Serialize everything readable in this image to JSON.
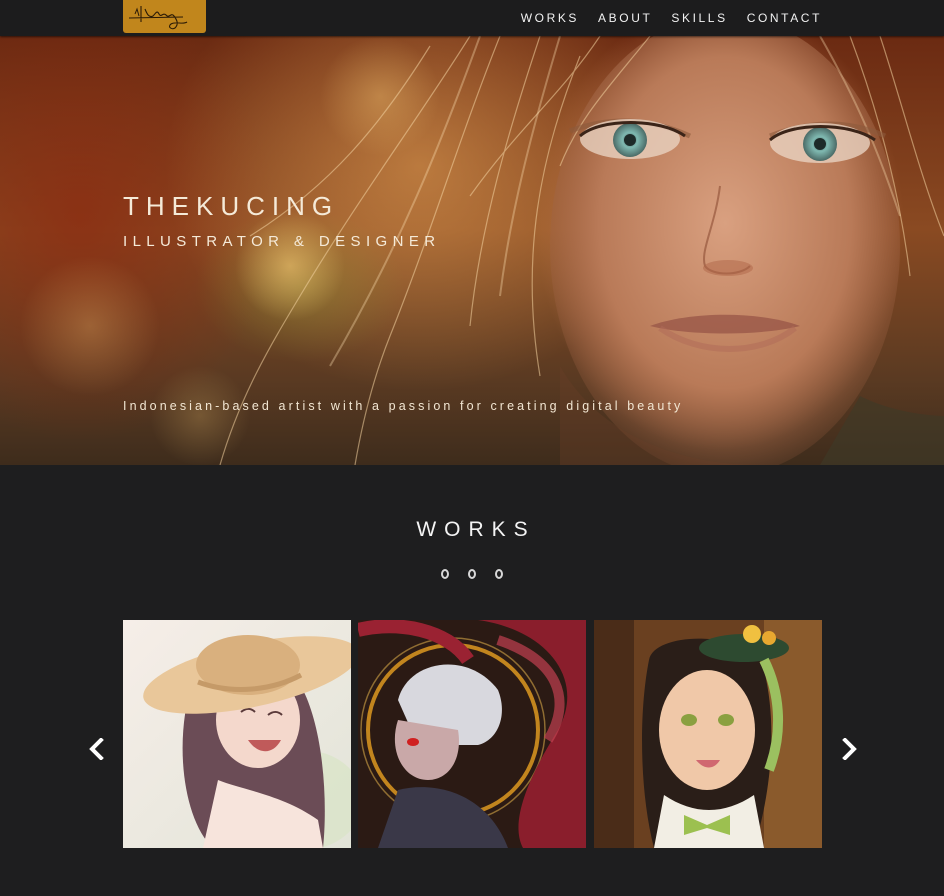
{
  "nav": {
    "logo_alt": "thekucing signature logo",
    "links": [
      "WORKS",
      "ABOUT",
      "SKILLS",
      "CONTACT"
    ]
  },
  "hero": {
    "title": "THEKUCING",
    "subtitle": "ILLUSTRATOR & DESIGNER",
    "tagline": "Indonesian-based artist with a passion for creating digital beauty"
  },
  "works": {
    "title": "WORKS",
    "items": [
      {
        "alt": "girl in straw hat illustration"
      },
      {
        "alt": "white-haired character with red wings illustration"
      },
      {
        "alt": "girl with green bow illustration"
      }
    ]
  },
  "colors": {
    "background": "#1e1e1f",
    "navbar": "#1c1c1d",
    "logo_accent": "#c1861c",
    "text": "#f4f4f4"
  },
  "icons": {
    "prev": "chevron-left-icon",
    "next": "chevron-right-icon",
    "ornament": "ring-dots-icon"
  }
}
